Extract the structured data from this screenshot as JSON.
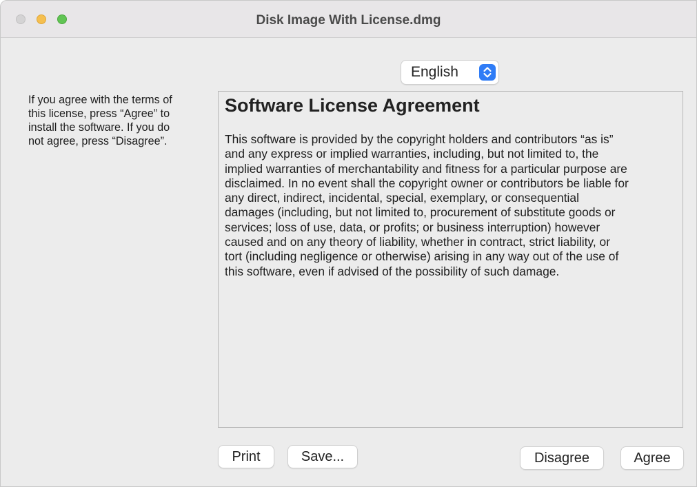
{
  "window": {
    "title": "Disk Image With License.dmg"
  },
  "language": {
    "selected": "English"
  },
  "instructions": {
    "text": "If you agree with the terms of\nthis license, press “Agree” to\ninstall the software. If you do\nnot agree, press “Disagree”."
  },
  "license": {
    "heading": "Software License Agreement",
    "lines": [
      "This software is provided by the copyright holders and contributors “as is”",
      "and any express or implied warranties, including, but not limited to, the",
      "implied warranties of merchantability and fitness for a particular purpose are",
      "disclaimed. In no event shall the copyright owner or contributors be liable for",
      "any direct, indirect, incidental, special, exemplary, or consequential",
      "damages (including, but not limited to, procurement of substitute goods or",
      "services; loss of use, data, or profits; or business interruption) however",
      "caused and on any theory of liability, whether in contract, strict liability, or",
      "tort (including negligence or otherwise) arising in any way out of the use of",
      "this software, even if advised of the possibility of such damage."
    ]
  },
  "buttons": {
    "print": "Print",
    "save": "Save...",
    "disagree": "Disagree",
    "agree": "Agree"
  },
  "colors": {
    "accent": "#2f7cf6",
    "close": "#d4d3d4",
    "minimize": "#f5bf4f",
    "maximize": "#61c454"
  },
  "icons": {
    "language_arrows": "chevron-up-down-icon"
  }
}
